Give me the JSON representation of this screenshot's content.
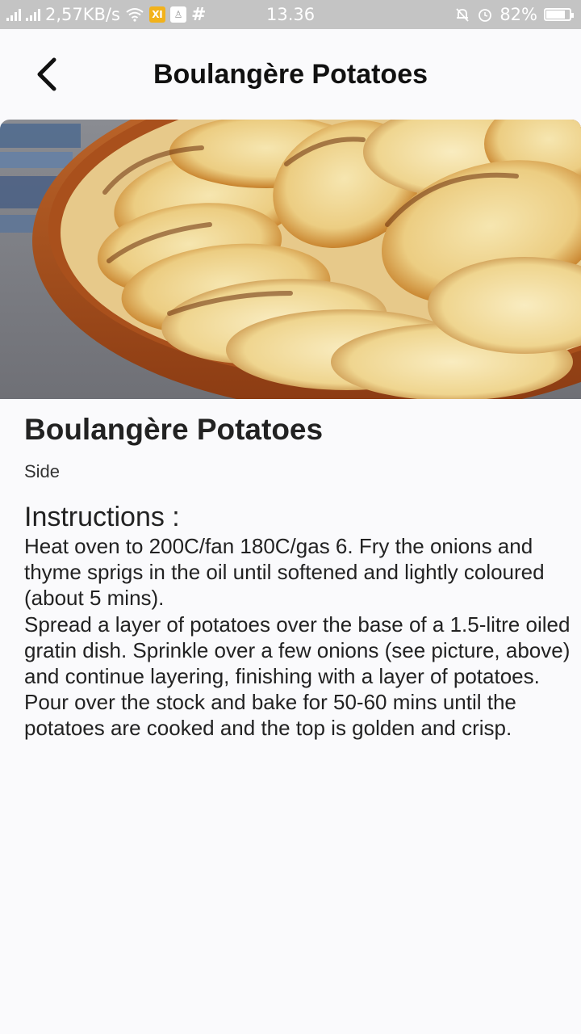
{
  "status_bar": {
    "network_speed": "2,57KB/s",
    "time": "13.36",
    "battery_percent": "82%",
    "battery_level": 0.82
  },
  "app_bar": {
    "title": "Boulangère Potatoes",
    "back_icon": "chevron-left-icon"
  },
  "hero_image": {
    "subject": "potatoes-gratin-photo"
  },
  "recipe": {
    "title": "Boulangère Potatoes",
    "category": "Side",
    "instructions_heading": "Instructions :",
    "instructions": "Heat oven to 200C/fan 180C/gas 6. Fry the onions and thyme sprigs in the oil until softened and lightly coloured (about 5 mins).\nSpread a layer of potatoes over the base of a 1.5-litre oiled gratin dish. Sprinkle over a few onions (see picture, above) and continue layering, finishing with a layer of potatoes. Pour over the stock and bake for 50-60 mins until the potatoes are cooked and the top is golden and crisp."
  },
  "colors": {
    "background": "#fafafc",
    "status_bar": "#c4c4c4",
    "text": "#222222"
  }
}
